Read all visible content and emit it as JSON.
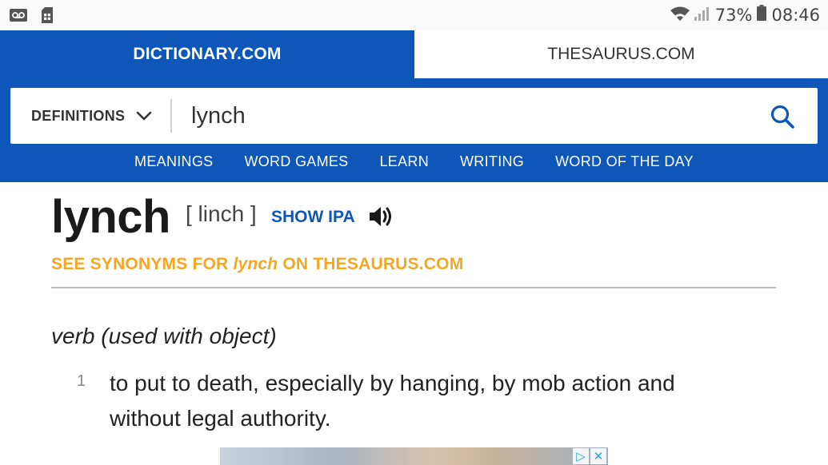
{
  "status_bar": {
    "battery": "73%",
    "time": "08:46"
  },
  "site_tabs": {
    "dictionary": "DICTIONARY.COM",
    "thesaurus": "THESAURUS.COM"
  },
  "search": {
    "mode_label": "DEFINITIONS",
    "value": "lynch"
  },
  "nav": [
    "MEANINGS",
    "WORD GAMES",
    "LEARN",
    "WRITING",
    "WORD OF THE DAY"
  ],
  "entry": {
    "headword": "lynch",
    "pronunciation": "[ linch ]",
    "show_ipa": "SHOW IPA",
    "synonyms_prefix": "SEE SYNONYMS FOR ",
    "synonyms_word": "lynch",
    "synonyms_suffix": " ON THESAURUS.COM",
    "part_of_speech": "verb (used with object)",
    "definitions": [
      {
        "number": "1",
        "text": "to put to death, especially by hanging, by mob action and without legal authority."
      }
    ]
  },
  "colors": {
    "brand_blue": "#0e57b8",
    "synonym_orange": "#f5a623"
  },
  "icons": {
    "voicemail": "voicemail-icon",
    "sim": "sim-card-icon",
    "wifi": "wifi-icon",
    "signal": "signal-icon",
    "battery": "battery-icon",
    "dropdown": "chevron-down-icon",
    "search": "search-icon",
    "audio": "speaker-icon",
    "ad_choices": "adchoices-icon",
    "ad_close": "close-icon"
  }
}
